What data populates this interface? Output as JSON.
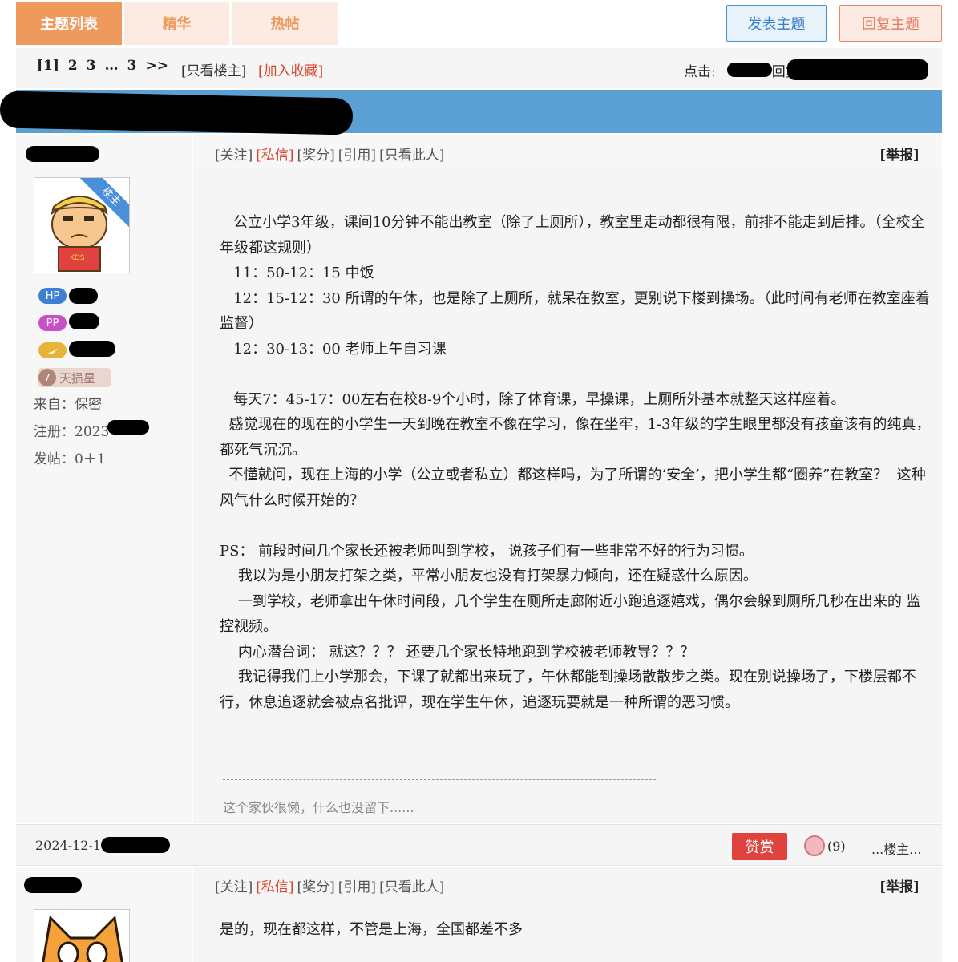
{
  "tabs": [
    {
      "label": "主题列表",
      "active": true
    },
    {
      "label": "精华",
      "active": false
    },
    {
      "label": "热帖",
      "active": false
    }
  ],
  "actions": {
    "new_topic": "发表主题",
    "reply_topic": "回复主题"
  },
  "pager": {
    "pages": [
      "[1]",
      "2",
      "3",
      "…",
      "3",
      ">>"
    ],
    "only_owner": "[只看楼主]",
    "add_fav": "[加入收藏]"
  },
  "stats": {
    "views_label": "点击:",
    "replies_label": "回复:"
  },
  "colors": {
    "accent_orange": "#ee9a5c",
    "title_bar_blue": "#5aa0d4",
    "link_red": "#d9442c",
    "zan_red": "#e0433d"
  },
  "post1": {
    "links": {
      "follow": "[关注]",
      "pm": "[私信]",
      "reward": "[奖分]",
      "quote": "[引用]",
      "only_this": "[只看此人]"
    },
    "report": "[举报]",
    "author_badge": "楼主",
    "badges": {
      "hp": "HP",
      "pp": "PP"
    },
    "rank": {
      "icon": "7",
      "label": "天损星"
    },
    "from": "来自：保密",
    "register": "注册：2023-",
    "posts": "发帖：0＋1",
    "content": [
      "   公立小学3年级，课间10分钟不能出教室（除了上厕所），教室里走动都很有限，前排不能走到后排。（全校全年级都这规则）",
      "   11：50-12：15 中饭",
      "   12：15-12：30 所谓的午休，也是除了上厕所，就呆在教室，更别说下楼到操场。（此时间有老师在教室座着监督）",
      "   12：30-13：00 老师上午自习课",
      "",
      "   每天7：45-17：00左右在校8-9个小时，除了体育课，早操课，上厕所外基本就整天这样座着。",
      "  感觉现在的现在的小学生一天到晚在教室不像在学习，像在坐牢，1-3年级的学生眼里都没有孩童该有的纯真，都死气沉沉。",
      "  不懂就问，现在上海的小学（公立或者私立）都这样吗，为了所谓的‘安全’，把小学生都“圈养”在教室？  这种风气什么时候开始的？",
      "",
      "PS： 前段时间几个家长还被老师叫到学校， 说孩子们有一些非常不好的行为习惯。",
      "    我以为是小朋友打架之类，平常小朋友也没有打架暴力倾向，还在疑惑什么原因。",
      "    一到学校，老师拿出午休时间段，几个学生在厕所走廊附近小跑追逐嬉戏，偶尔会躲到厕所几秒在出来的 监控视频。",
      "    内心潜台词： 就这？？？ 还要几个家长特地跑到学校被老师教导？？？",
      "    我记得我们上小学那会，下课了就都出来玩了，午休都能到操场散散步之类。现在别说操场了，下楼层都不行，休息追逐就会被点名批评，现在学生午休，追逐玩要就是一种所谓的恶习惯。"
    ],
    "signature": "这个家伙很懒，什么也没留下......",
    "date": "2024-12-1",
    "zan": "赞赏",
    "smile_count": "(9)",
    "owner_link": "...楼主..."
  },
  "post2": {
    "links": {
      "follow": "[关注]",
      "pm": "[私信]",
      "reward": "[奖分]",
      "quote": "[引用]",
      "only_this": "[只看此人]"
    },
    "report": "[举报]",
    "content": "是的，现在都这样，不管是上海，全国都差不多"
  }
}
